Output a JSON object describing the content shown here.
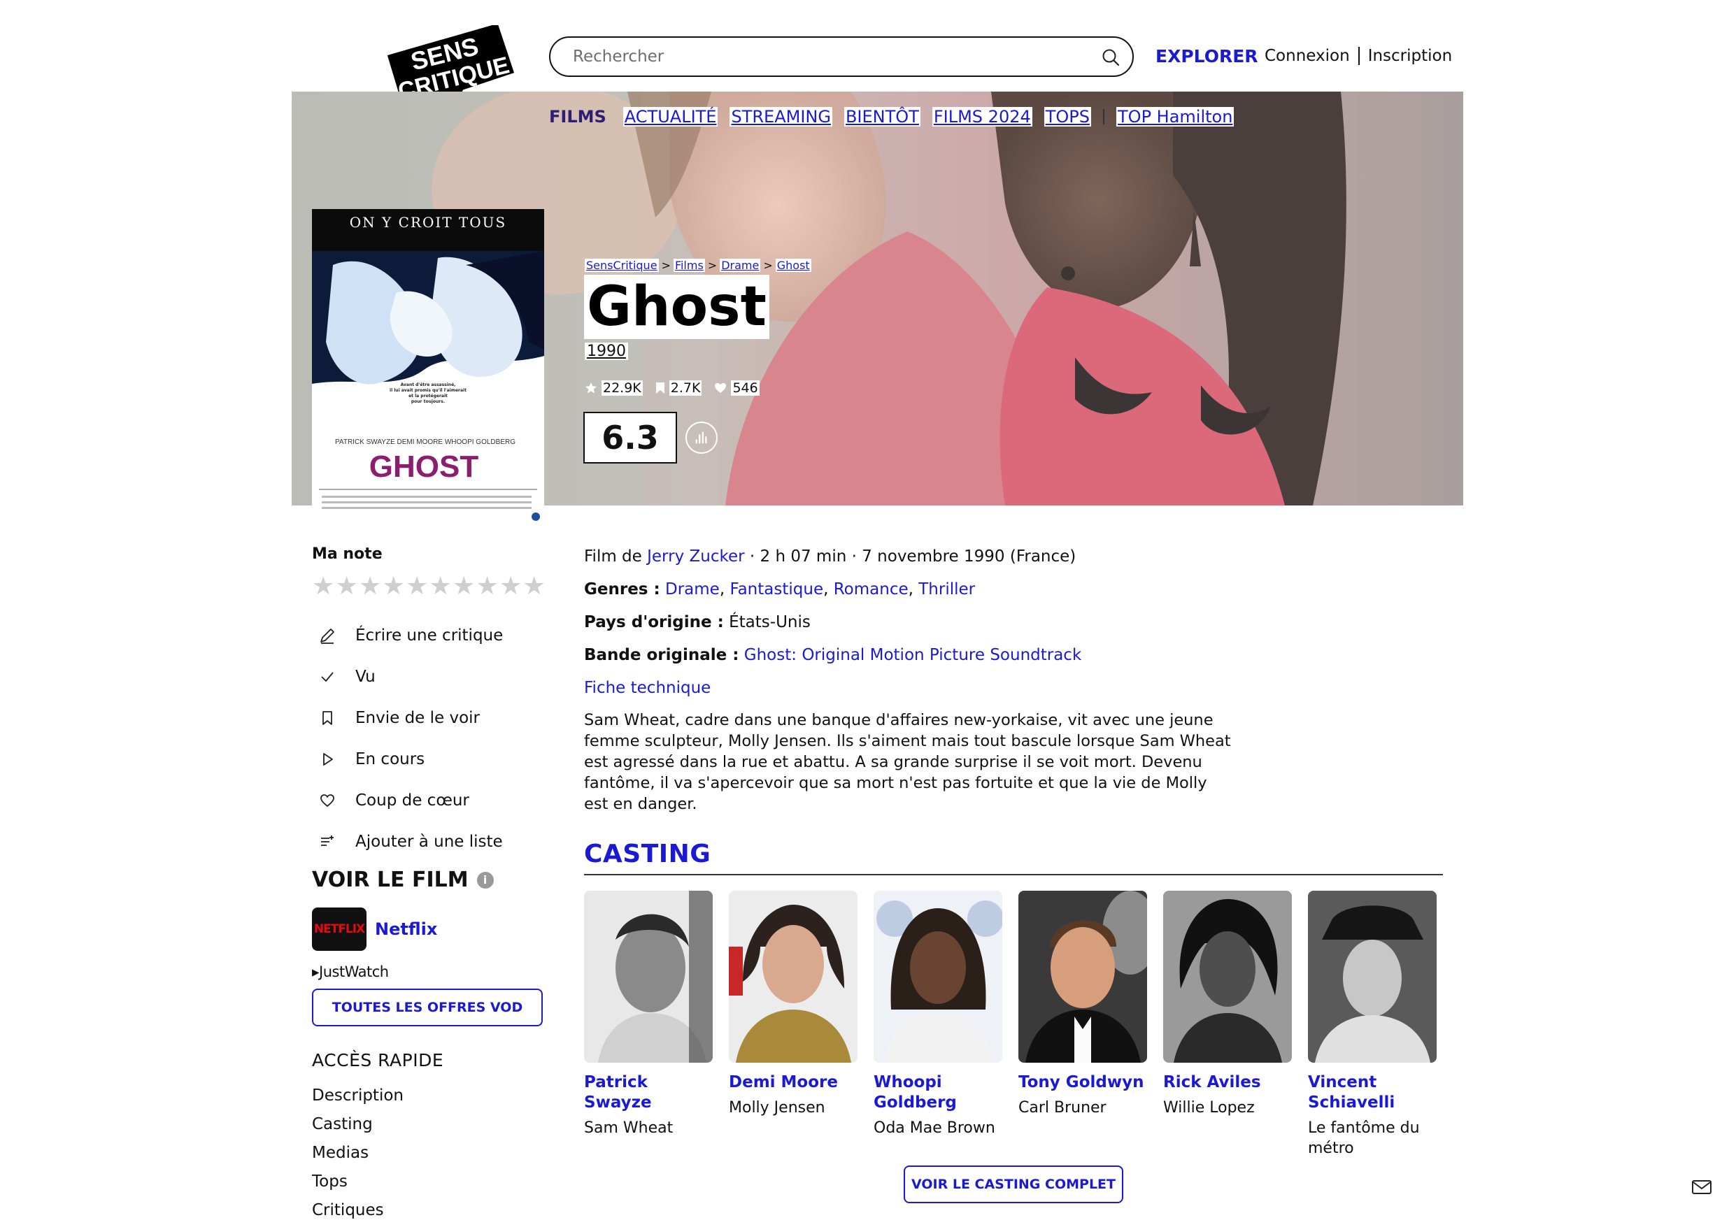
{
  "header": {
    "logo_text": [
      "SENS",
      "CRITIQUE"
    ],
    "search_placeholder": "Rechercher",
    "explorer": "EXPLORER",
    "login": "Connexion",
    "signup": "Inscription"
  },
  "nav": {
    "active": "FILMS",
    "items": [
      "ACTUALITÉ",
      "STREAMING",
      "BIENTÔT",
      "FILMS 2024",
      "TOPS"
    ],
    "extra": "TOP Hamilton"
  },
  "poster": {
    "tagline": "ON Y CROIT TOUS",
    "fine_print": [
      "Avant d'être assassiné,",
      "il lui avait promis qu'il l'aimerait",
      "et la protégerait",
      "pour toujours."
    ],
    "cast_line": "PATRICK SWAYZE   DEMI MOORE   WHOOPI GOLDBERG",
    "title": "GHOST"
  },
  "breadcrumb": [
    "SensCritique",
    "Films",
    "Drame",
    "Ghost"
  ],
  "film": {
    "title": "Ghost",
    "year": "1990",
    "ratings_count": "22.9K",
    "wishlist_count": "2.7K",
    "favorites_count": "546",
    "score": "6.3",
    "director_prefix": "Film de",
    "director": "Jerry Zucker",
    "meta": "· 2 h 07 min · 7 novembre 1990 (France)",
    "genres_label": "Genres :",
    "genres": [
      "Drame",
      "Fantastique",
      "Romance",
      "Thriller"
    ],
    "country_label": "Pays d'origine :",
    "country": "États-Unis",
    "soundtrack_label": "Bande originale :",
    "soundtrack": "Ghost: Original Motion Picture Soundtrack",
    "tech_sheet": "Fiche technique",
    "synopsis": "Sam Wheat, cadre dans une banque d'affaires new-yorkaise, vit avec une jeune femme sculpteur, Molly Jensen. Ils s'aiment mais tout bascule lorsque Sam Wheat est agressé dans la rue et abattu. A sa grande surprise il se voit mort. Devenu fantôme, il va s'apercevoir que sa mort n'est pas fortuite et que la vie de Molly est en danger."
  },
  "sidebar": {
    "my_rating": "Ma note",
    "stars": 10,
    "actions": [
      {
        "label": "Écrire une critique",
        "icon": "pencil-icon"
      },
      {
        "label": "Vu",
        "icon": "check-icon"
      },
      {
        "label": "Envie de le voir",
        "icon": "bookmark-icon"
      },
      {
        "label": "En cours",
        "icon": "play-icon"
      },
      {
        "label": "Coup de cœur",
        "icon": "heart-icon"
      },
      {
        "label": "Ajouter à une liste",
        "icon": "list-add-icon"
      }
    ],
    "watch_title": "VOIR LE FILM",
    "provider_logo": "NETFLIX",
    "provider": "Netflix",
    "justwatch": "JustWatch",
    "vod_button": "TOUTES LES OFFRES VOD",
    "quick_access_title": "ACCÈS RAPIDE",
    "quick_access": [
      "Description",
      "Casting",
      "Medias",
      "Tops",
      "Critiques"
    ]
  },
  "casting": {
    "title": "CASTING",
    "full_button": "VOIR LE CASTING COMPLET",
    "actors": [
      {
        "name": "Patrick Swayze",
        "role": "Sam Wheat"
      },
      {
        "name": "Demi Moore",
        "role": "Molly Jensen"
      },
      {
        "name": "Whoopi Goldberg",
        "role": "Oda Mae Brown"
      },
      {
        "name": "Tony Goldwyn",
        "role": "Carl Bruner"
      },
      {
        "name": "Rick Aviles",
        "role": "Willie Lopez"
      },
      {
        "name": "Vincent Schiavelli",
        "role": "Le fantôme du métro"
      }
    ]
  },
  "colors": {
    "link": "#1a1ad6",
    "nav_active": "#2d1e75",
    "hero_tint": "#d48a8f"
  }
}
